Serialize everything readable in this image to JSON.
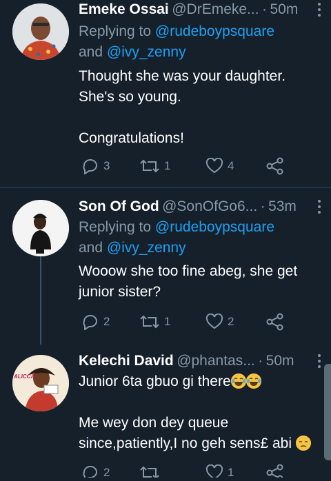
{
  "tweets": [
    {
      "name": "Emeke Ossai",
      "handle": "@DrEmeke...",
      "dot": "·",
      "time": "50m",
      "replying_prefix": "Replying to",
      "reply_to_1": "@rudeboypsquare",
      "reply_and": "and",
      "reply_to_2": "@ivy_zenny",
      "text_line1": "Thought she was your daughter.",
      "text_line2": "She's so young.",
      "text_line3": "Congratulations!",
      "replies": "3",
      "retweets": "1",
      "likes": "4",
      "avatar_icon": "profile-photo"
    },
    {
      "name": "Son Of God",
      "handle": "@SonOfGo6...",
      "dot": "·",
      "time": "53m",
      "replying_prefix": "Replying to",
      "reply_to_1": "@rudeboypsquare",
      "reply_and": "and",
      "reply_to_2": "@ivy_zenny",
      "text_line1": "Wooow she too fine abeg, she get",
      "text_line2": "junior sister?",
      "replies": "2",
      "retweets": "1",
      "likes": "2",
      "avatar_icon": "profile-photo"
    },
    {
      "name": "Kelechi David",
      "handle": "@phantas...",
      "dot": "·",
      "time": "50m",
      "text_line1": "Junior 6ta gbuo gi there",
      "text_line2": "Me wey don dey queue",
      "text_line3": "since,patiently,I no geh sens£ abi",
      "avatar_label": "ALICCA",
      "replies": "2",
      "likes": "1",
      "avatar_icon": "profile-photo"
    }
  ],
  "colors": {
    "background": "#15202b",
    "secondary_text": "#8899a6",
    "mention": "#1da1f2",
    "divider": "#253341"
  },
  "icons": [
    "reply-icon",
    "retweet-icon",
    "like-icon",
    "share-icon",
    "more-icon",
    "laughing-crying-emoji",
    "unamused-emoji"
  ]
}
